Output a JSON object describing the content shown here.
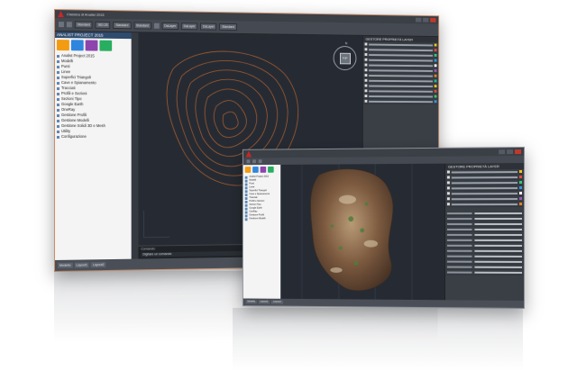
{
  "back_window": {
    "title": "Classica di Analist 2015",
    "ribbon_combos": [
      "Standard",
      "ISO-25",
      "Standard",
      "Standard",
      "DaLayer",
      "DaLayer",
      "DaLayer",
      "Standard"
    ],
    "left_panel_title": "ANALIST PROJECT 2015",
    "tree": [
      "Analist Project 2015",
      "Modelli",
      "Punti",
      "Linee",
      "Superfici Triangoli",
      "Cave e Spianamento",
      "Tracciati",
      "Profili e Sezioni",
      "Sezioni Tipo",
      "Google Earth",
      "OneRay",
      "Gestione Profili",
      "Gestione Modelli",
      "Gestione Solidi 3D e Mesh",
      "Utility",
      "Configurazione"
    ],
    "right_panel_title": "GESTORE PROPRIETÀ LAYER",
    "compass_label": "N",
    "cube_label": "TOP",
    "command_label": "Comando:",
    "command_input": "Digitare un comando",
    "status_tabs": [
      "Modello",
      "Layout1",
      "Layout2"
    ]
  },
  "front_window": {
    "left_panel_title": "Analist Project 2015",
    "right_panel_title": "GESTORE PROPRIETÀ LAYER",
    "status_tabs": [
      "Modello",
      "Layout1",
      "Layout2"
    ]
  },
  "colors": {
    "contour": "#b5622f",
    "canvas": "#262b33",
    "accent": "#c62828"
  }
}
